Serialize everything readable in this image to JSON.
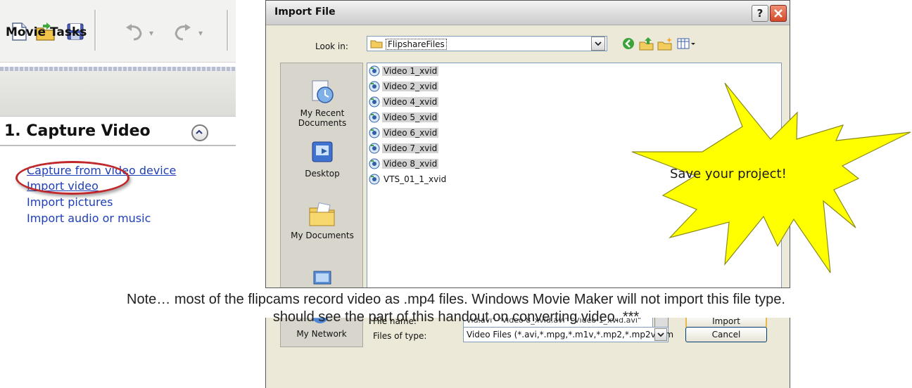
{
  "movie_maker": {
    "toolbar": {
      "icons": [
        "new-project-icon",
        "open-project-icon",
        "save-project-icon",
        "undo-icon",
        "redo-icon"
      ]
    },
    "tasks_title": "Movie Tasks",
    "section_title": "1. Capture Video",
    "links": {
      "capture": "Capture from video device",
      "import_video": "Import video",
      "import_pictures": "Import pictures",
      "import_audio": "Import audio or music"
    },
    "highlight_color": "#c0282b",
    "link_color": "#1f3fb7"
  },
  "dialog": {
    "title": "Import File",
    "help_label": "?",
    "look_in_label": "Look in:",
    "look_in_value": "FlipshareFiles",
    "places": {
      "recent": "My Recent Documents",
      "desktop": "Desktop",
      "documents": "My Documents",
      "network": "My Network"
    },
    "files": [
      {
        "name": "Video 1_xvid",
        "selected": true
      },
      {
        "name": "Video 2_xvid",
        "selected": true
      },
      {
        "name": "Video 4_xvid",
        "selected": true
      },
      {
        "name": "Video 5_xvid",
        "selected": true
      },
      {
        "name": "Video 6_xvid",
        "selected": true
      },
      {
        "name": "Video 7_xvid",
        "selected": true
      },
      {
        "name": "Video 8_xvid",
        "selected": true
      },
      {
        "name": "VTS_01_1_xvid",
        "selected": false
      }
    ],
    "file_name_label": "File name:",
    "file_name_value": "vid.avi\" \"Video 8_xvid.avi\" \"Video 1_xvid.avi\"",
    "files_of_type_label": "Files of type:",
    "files_of_type_value": "Video Files (*.avi,*.mpg,*.m1v,*.mp2,*.mp2v,*.m",
    "import_label": "Import",
    "cancel_label": "Cancel"
  },
  "callout": {
    "text": "Save your project!",
    "fill": "#ffff00"
  },
  "note": {
    "line1": "Note… most of the flipcams record video as .mp4 files.  Windows Movie Maker will not import this file type.",
    "line2": "should see the part of this handout on converting video. ***"
  }
}
